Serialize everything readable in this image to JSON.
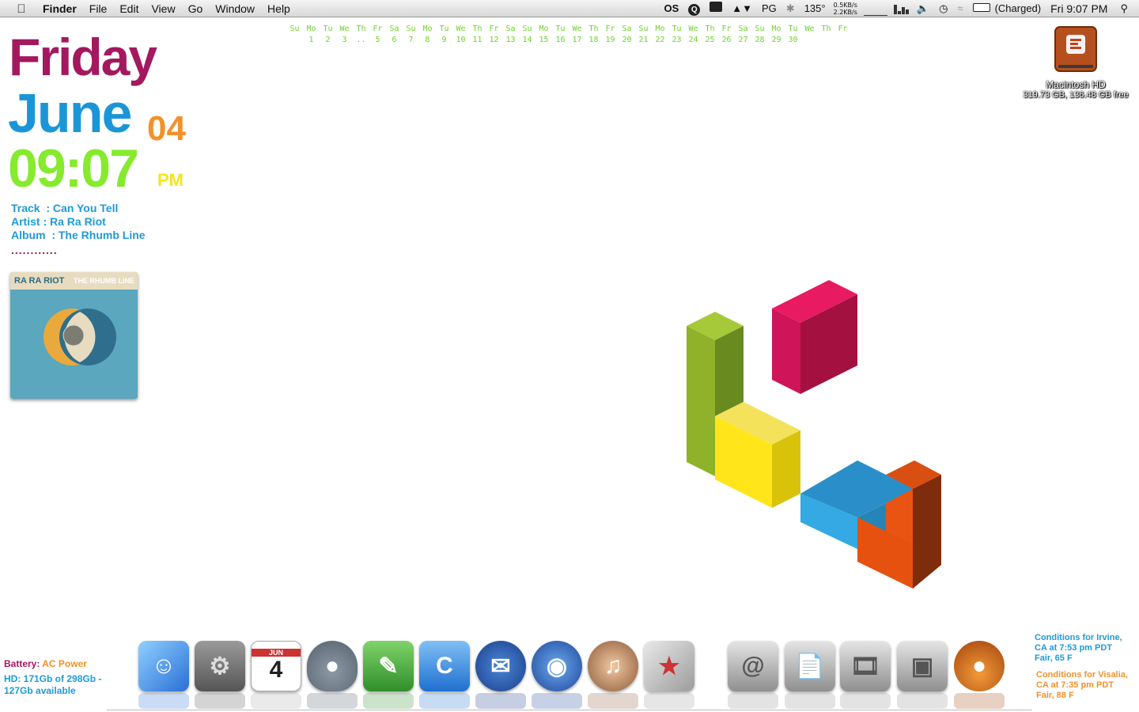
{
  "menubar": {
    "app_name": "Finder",
    "menus": [
      "File",
      "Edit",
      "View",
      "Go",
      "Window",
      "Help"
    ],
    "status": {
      "os_label": "OS",
      "pg_label": "PG",
      "temperature": "135°",
      "net_up": "0.5KB/s",
      "net_down": "2.2KB/s",
      "battery_status": "(Charged)",
      "clock": "Fri 9:07 PM"
    }
  },
  "calendar": {
    "weekdays": [
      "Su",
      "Mo",
      "Tu",
      "We",
      "Th",
      "Fr",
      "Sa",
      "Su",
      "Mo",
      "Tu",
      "We",
      "Th",
      "Fr",
      "Sa",
      "Su",
      "Mo",
      "Tu",
      "We",
      "Th",
      "Fr",
      "Sa",
      "Su",
      "Mo",
      "Tu",
      "We",
      "Th",
      "Fr",
      "Sa",
      "Su",
      "Mo",
      "Tu",
      "We",
      "Th",
      "Fr"
    ],
    "days": [
      "",
      "1",
      "2",
      "3",
      "..",
      "5",
      "6",
      "7",
      "8",
      "9",
      "10",
      "11",
      "12",
      "13",
      "14",
      "15",
      "16",
      "17",
      "18",
      "19",
      "20",
      "21",
      "22",
      "23",
      "24",
      "25",
      "26",
      "27",
      "28",
      "29",
      "30",
      "",
      "",
      ""
    ]
  },
  "clock": {
    "day": "Friday",
    "month": "June",
    "date": "04",
    "time": "09:07",
    "ampm": "PM"
  },
  "now_playing": {
    "track_line": "Track  : Can You Tell",
    "artist_line": "Artist : Ra Ra Riot",
    "album_line": "Album  : The Rhumb Line",
    "dots": "............",
    "art_artist": "RA RA RIOT",
    "art_title": "THE RHUMB LINE"
  },
  "drive": {
    "name": "Macintosh HD",
    "info": "319.73 GB, 136.48 GB free"
  },
  "sysinfo": {
    "battery_key": "Battery:",
    "battery_value": "AC Power",
    "hd_line": "HD:  171Gb of 298Gb - 127Gb available"
  },
  "weather": {
    "irvine_line1": "Conditions for Irvine,",
    "irvine_line2": "CA at 7:53 pm PDT",
    "irvine_line3": "Fair, 65 F",
    "visalia_line1": "Conditions for Visalia,",
    "visalia_line2": "CA at 7:35 pm PDT",
    "visalia_line3": "Fair, 88 F"
  },
  "dock": {
    "calendar_month": "JUN",
    "calendar_day": "4",
    "apps": [
      "finder-icon",
      "system-preferences-icon",
      "ical-icon",
      "totoro-icon",
      "evernote-icon",
      "cyberduck-icon",
      "thunderbird-icon",
      "firefox-icon",
      "adium-icon",
      "iphoto-icon",
      "applications-stack-icon",
      "documents-stack-icon",
      "movies-stack-icon",
      "pictures-stack-icon",
      "bomb-icon"
    ]
  },
  "colors": {
    "magenta": "#a3185f",
    "blue": "#1a96d8",
    "orange": "#f3912a",
    "green": "#86ea2e",
    "yellow": "#f7e31b"
  }
}
